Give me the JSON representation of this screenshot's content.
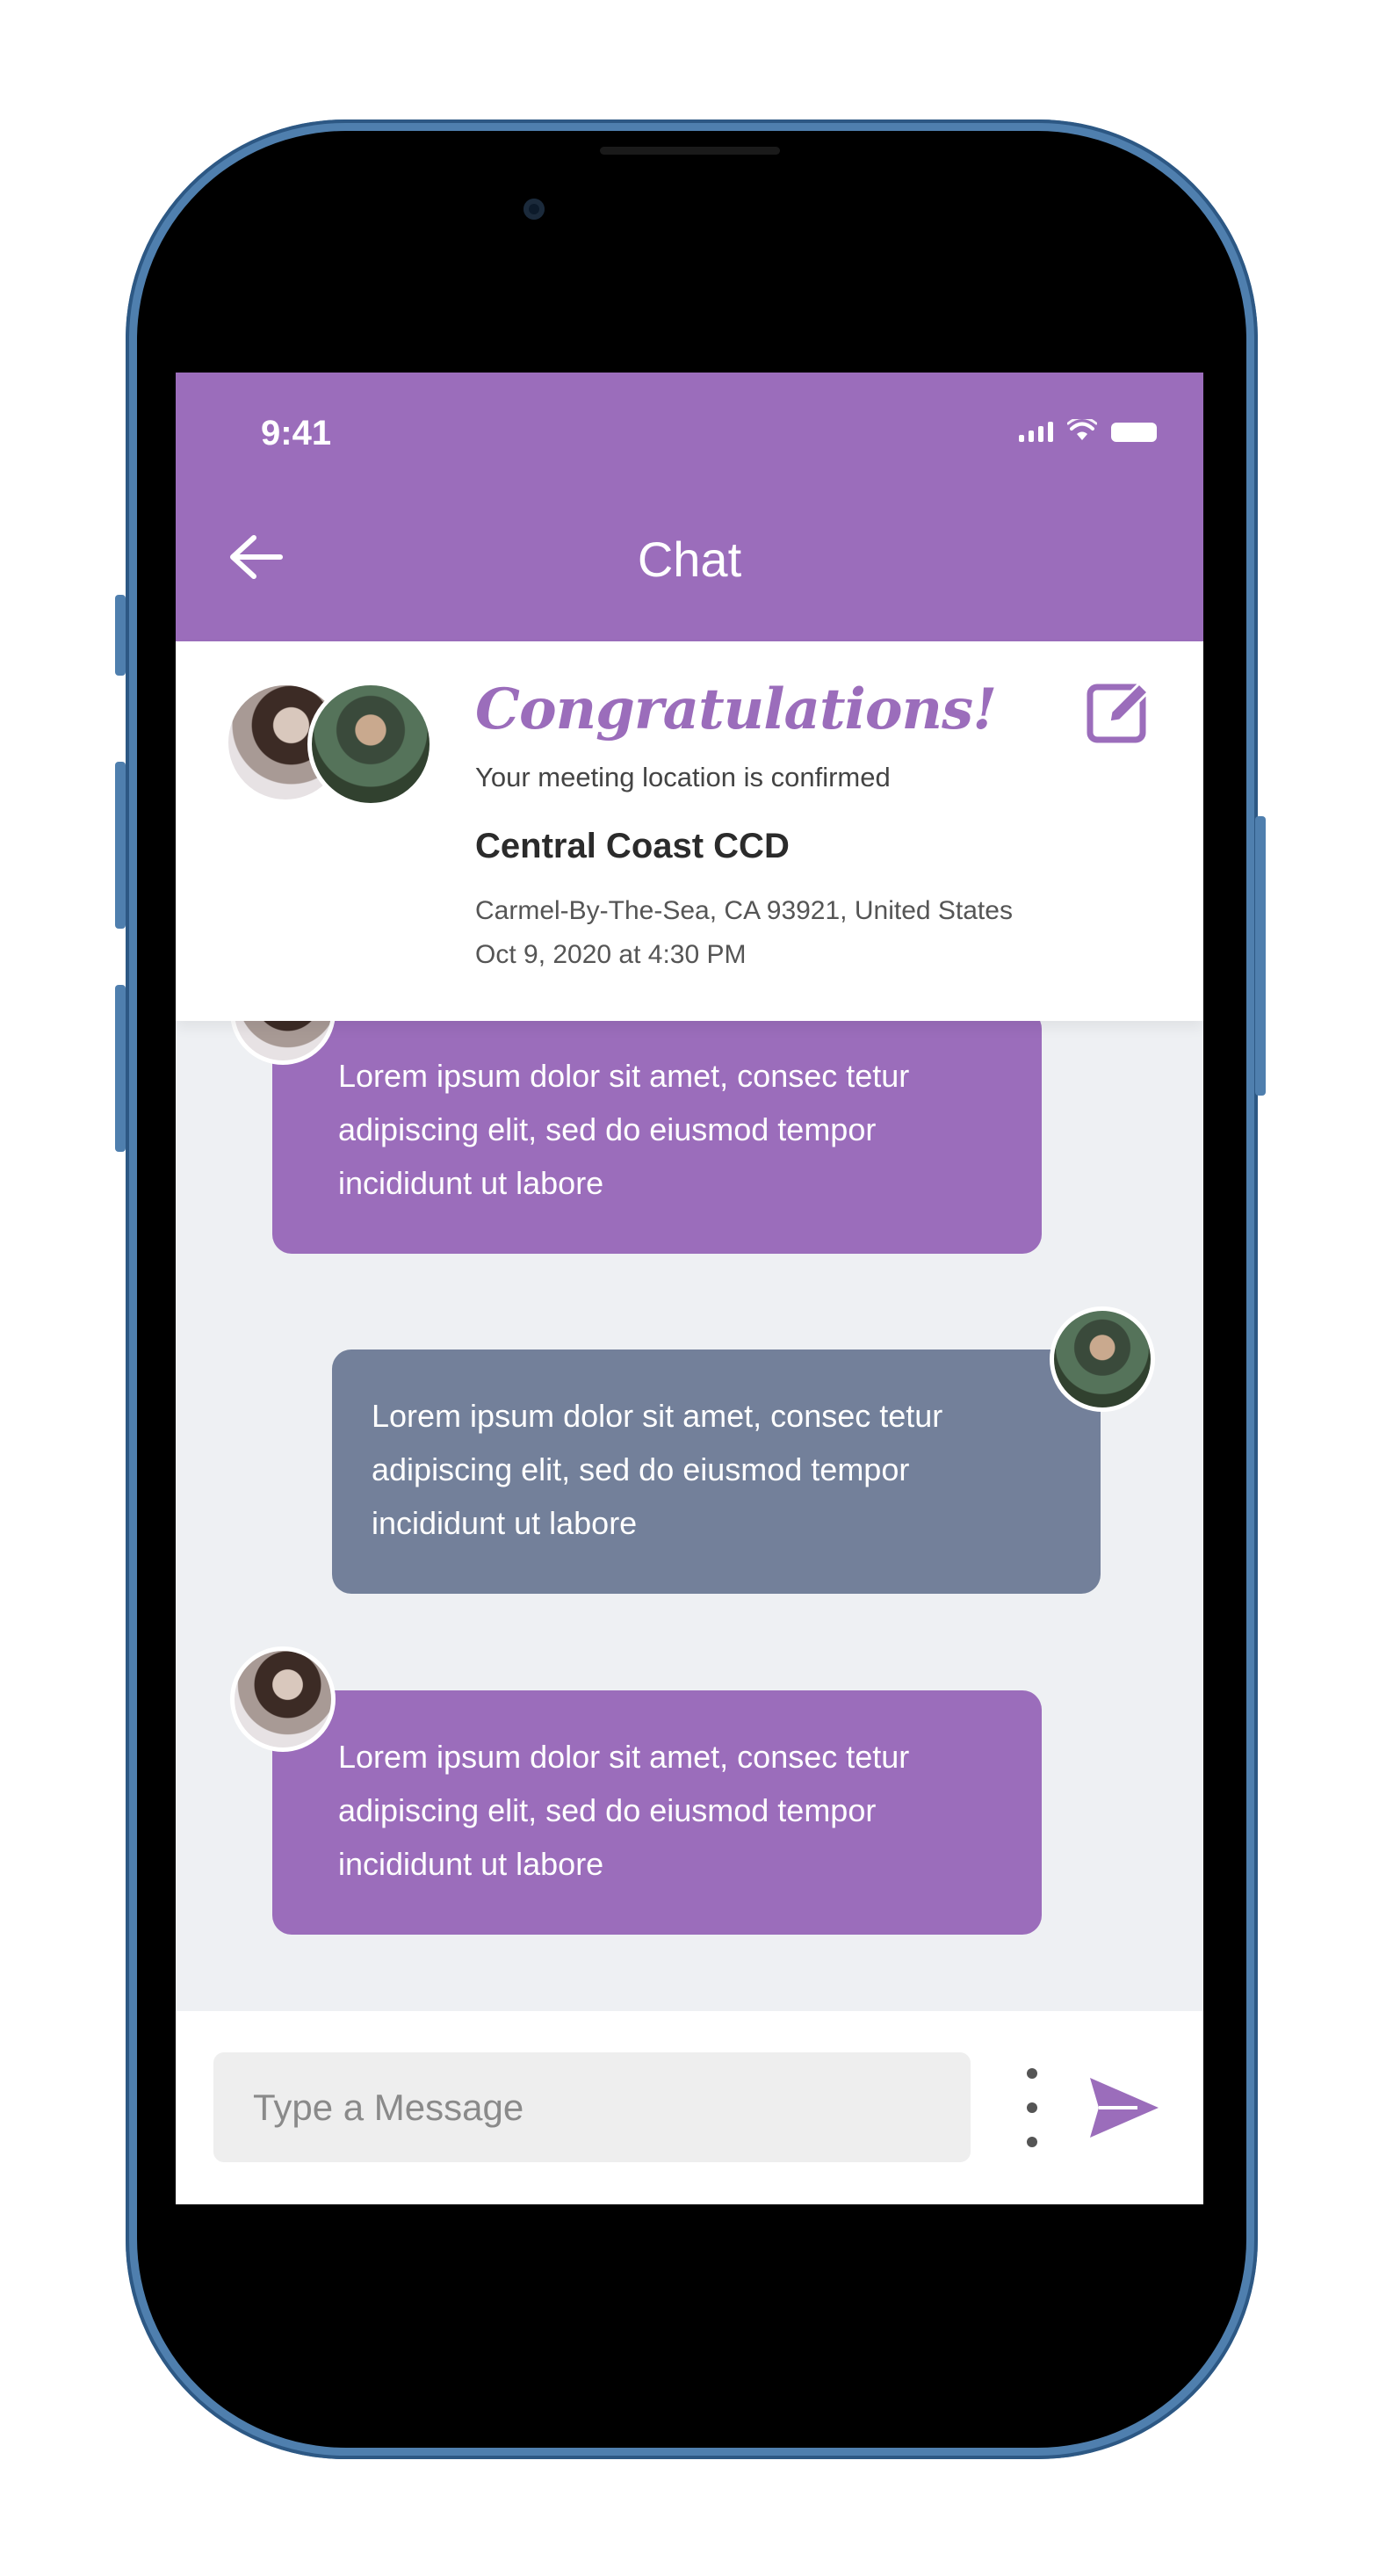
{
  "colors": {
    "accent": "#9b6dbb",
    "bubble_self": "#73809a",
    "frame": "#4f7fae"
  },
  "status_bar": {
    "time": "9:41",
    "icons": [
      "cellular-signal-icon",
      "wifi-icon",
      "battery-icon"
    ]
  },
  "header": {
    "title": "Chat",
    "back_icon": "arrow-left-icon"
  },
  "confirmation": {
    "heading": "Congratulations!",
    "subtitle": "Your meeting location is confirmed",
    "place_name": "Central Coast CCD",
    "address": "Carmel-By-The-Sea, CA 93921, United States",
    "datetime": "Oct 9, 2020 at 4:30 PM",
    "edit_icon": "edit-icon"
  },
  "messages": [
    {
      "sender": "them",
      "text": "Lorem ipsum dolor sit amet, consec tetur adipiscing elit, sed do eiusmod tempor incididunt ut labore"
    },
    {
      "sender": "me",
      "text": "Lorem ipsum dolor sit amet, consec tetur adipiscing elit, sed do eiusmod tempor incididunt ut labore"
    },
    {
      "sender": "them",
      "text": "Lorem ipsum dolor sit amet, consec tetur adipiscing elit, sed do eiusmod tempor incididunt ut labore"
    }
  ],
  "composer": {
    "placeholder": "Type a Message",
    "value": "",
    "more_icon": "more-vertical-icon",
    "send_icon": "send-icon"
  }
}
